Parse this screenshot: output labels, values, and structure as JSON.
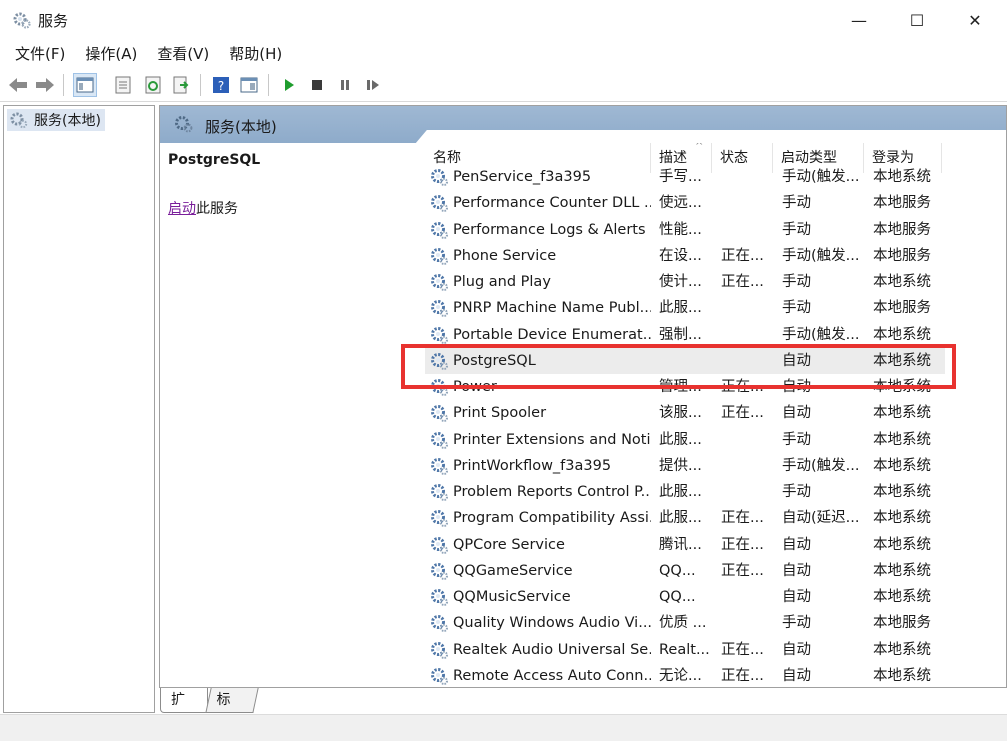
{
  "window": {
    "title": "服务",
    "controls": {
      "minimize": "—",
      "maximize": "☐",
      "close": "✕"
    }
  },
  "menu": [
    "文件(F)",
    "操作(A)",
    "查看(V)",
    "帮助(H)"
  ],
  "toolbar": {
    "icons": [
      "back-arrow-icon",
      "forward-arrow-icon",
      "show-console-tree-icon",
      "properties-icon",
      "refresh-icon",
      "export-list-icon",
      "help-icon",
      "view-icon",
      "start-service-icon",
      "stop-service-icon",
      "pause-service-icon",
      "restart-service-icon"
    ]
  },
  "tree": {
    "root_label": "服务(本地)"
  },
  "pane": {
    "header": "服务(本地)",
    "detail": {
      "service_name": "PostgreSQL",
      "start_link": "启动",
      "start_suffix": "此服务"
    }
  },
  "columns": {
    "name": "名称",
    "description": "描述",
    "status": "状态",
    "startup": "启动类型",
    "logon": "登录为"
  },
  "rows": [
    {
      "name": "PenService_f3a395",
      "description": "手写...",
      "status": "",
      "startup": "手动(触发...",
      "logon": "本地系统"
    },
    {
      "name": "Performance Counter DLL ...",
      "description": "使远...",
      "status": "",
      "startup": "手动",
      "logon": "本地服务"
    },
    {
      "name": "Performance Logs & Alerts",
      "description": "性能...",
      "status": "",
      "startup": "手动",
      "logon": "本地服务"
    },
    {
      "name": "Phone Service",
      "description": "在设...",
      "status": "正在...",
      "startup": "手动(触发...",
      "logon": "本地服务"
    },
    {
      "name": "Plug and Play",
      "description": "使计...",
      "status": "正在...",
      "startup": "手动",
      "logon": "本地系统"
    },
    {
      "name": "PNRP Machine Name Publ...",
      "description": "此服...",
      "status": "",
      "startup": "手动",
      "logon": "本地服务"
    },
    {
      "name": "Portable Device Enumerat...",
      "description": "强制...",
      "status": "",
      "startup": "手动(触发...",
      "logon": "本地系统"
    },
    {
      "name": "PostgreSQL",
      "description": "",
      "status": "",
      "startup": "自动",
      "logon": "本地系统",
      "selected": true
    },
    {
      "name": "Power",
      "description": "管理...",
      "status": "正在...",
      "startup": "自动",
      "logon": "本地系统"
    },
    {
      "name": "Print Spooler",
      "description": "该服...",
      "status": "正在...",
      "startup": "自动",
      "logon": "本地系统"
    },
    {
      "name": "Printer Extensions and Noti...",
      "description": "此服...",
      "status": "",
      "startup": "手动",
      "logon": "本地系统"
    },
    {
      "name": "PrintWorkflow_f3a395",
      "description": "提供...",
      "status": "",
      "startup": "手动(触发...",
      "logon": "本地系统"
    },
    {
      "name": "Problem Reports Control P...",
      "description": "此服...",
      "status": "",
      "startup": "手动",
      "logon": "本地系统"
    },
    {
      "name": "Program Compatibility Assi...",
      "description": "此服...",
      "status": "正在...",
      "startup": "自动(延迟...",
      "logon": "本地系统"
    },
    {
      "name": "QPCore Service",
      "description": "腾讯...",
      "status": "正在...",
      "startup": "自动",
      "logon": "本地系统"
    },
    {
      "name": "QQGameService",
      "description": "QQ...",
      "status": "正在...",
      "startup": "自动",
      "logon": "本地系统"
    },
    {
      "name": "QQMusicService",
      "description": "QQ...",
      "status": "",
      "startup": "自动",
      "logon": "本地系统"
    },
    {
      "name": "Quality Windows Audio Vi...",
      "description": "优质 ...",
      "status": "",
      "startup": "手动",
      "logon": "本地服务"
    },
    {
      "name": "Realtek Audio Universal Se...",
      "description": "Realt...",
      "status": "正在...",
      "startup": "自动",
      "logon": "本地系统"
    },
    {
      "name": "Remote Access Auto Conn...",
      "description": "无论...",
      "status": "正在...",
      "startup": "自动",
      "logon": "本地系统"
    }
  ],
  "tabs": [
    "扩展",
    "标准"
  ],
  "colors": {
    "header_band": "#8eabca",
    "highlight_box": "#e8322f",
    "selected_row": "#ececec",
    "link": "#7a1e9a"
  }
}
